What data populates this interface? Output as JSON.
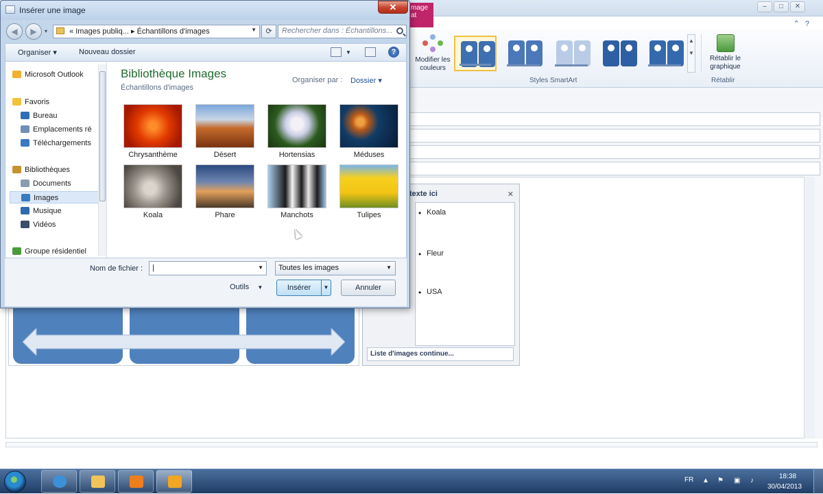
{
  "background_app": {
    "context_tab_label": "mage\nat",
    "ribbon": {
      "colors_button": "Modifier les\ncouleurs",
      "styles_group_label": "Styles SmartArt",
      "reset_button": "Rétablir le\ngraphique",
      "reset_group_label": "Rétablir"
    },
    "text_pane": {
      "title": "texte ici",
      "items": [
        "Koala",
        "Fleur",
        "USA"
      ],
      "footer": "Liste d'images continue..."
    }
  },
  "dialog": {
    "title": "Insérer une image",
    "address": {
      "prefix": "«",
      "path_1": "Images publiq...",
      "separator": "▸",
      "path_2": "Échantillons d'images"
    },
    "search_placeholder": "Rechercher dans : Échantillons...",
    "toolbar": {
      "organize": "Organiser ▾",
      "new_folder": "Nouveau dossier"
    },
    "nav_pane": [
      {
        "label": "Microsoft Outlook",
        "icon": "outlook-icon",
        "color": "#f0b030"
      },
      {
        "label": "Favoris",
        "icon": "star-icon",
        "color": "#f2c23a"
      },
      {
        "label": "Bureau",
        "icon": "desktop-icon",
        "color": "#2f6db5"
      },
      {
        "label": "Emplacements ré",
        "icon": "recent-places-icon",
        "color": "#6f8fb6"
      },
      {
        "label": "Téléchargements",
        "icon": "downloads-icon",
        "color": "#3b78c0"
      },
      {
        "label": "Bibliothèques",
        "icon": "libraries-icon",
        "color": "#c4922e"
      },
      {
        "label": "Documents",
        "icon": "documents-icon",
        "color": "#8a9bb2"
      },
      {
        "label": "Images",
        "icon": "pictures-icon",
        "color": "#3a7bbf"
      },
      {
        "label": "Musique",
        "icon": "music-icon",
        "color": "#2f69b0"
      },
      {
        "label": "Vidéos",
        "icon": "videos-icon",
        "color": "#3a4d6a"
      },
      {
        "label": "Groupe résidentiel",
        "icon": "homegroup-icon",
        "color": "#4b9a3c"
      }
    ],
    "library": {
      "title": "Bibliothèque Images",
      "subtitle": "Échantillons d'images",
      "arrange_label": "Organiser par :",
      "arrange_value": "Dossier ▾"
    },
    "thumbnails": [
      {
        "caption": "Chrysanthème",
        "colors": [
          "#ff6a00",
          "#c41e00"
        ]
      },
      {
        "caption": "Désert",
        "colors": [
          "#5a8fd0",
          "#b0471a"
        ]
      },
      {
        "caption": "Hortensias",
        "colors": [
          "#e8e4f0",
          "#2c5a1e"
        ]
      },
      {
        "caption": "Méduses",
        "colors": [
          "#e08a2a",
          "#0a2a50"
        ]
      },
      {
        "caption": "Koala",
        "colors": [
          "#b9b4ac",
          "#5f5a54"
        ]
      },
      {
        "caption": "Phare",
        "colors": [
          "#2d4f86",
          "#c97a3a"
        ]
      },
      {
        "caption": "Manchots",
        "colors": [
          "#9fc4e6",
          "#1b1b1b"
        ]
      },
      {
        "caption": "Tulipes",
        "colors": [
          "#f3c413",
          "#7a9a2a"
        ]
      }
    ],
    "footer": {
      "filename_label": "Nom de fichier :",
      "filename_value": "",
      "filter_value": "Toutes les images",
      "tools_label": "Outils",
      "insert_label": "Insérer",
      "cancel_label": "Annuler"
    }
  },
  "taskbar": {
    "language": "FR",
    "time": "18:38",
    "date": "30/04/2013",
    "apps": [
      {
        "name": "internet-explorer-icon",
        "color": "#3c90d8"
      },
      {
        "name": "file-explorer-icon",
        "color": "#f0c45a"
      },
      {
        "name": "media-player-icon",
        "color": "#ef7e1d"
      },
      {
        "name": "outlook-icon",
        "color": "#f2a623"
      }
    ]
  }
}
